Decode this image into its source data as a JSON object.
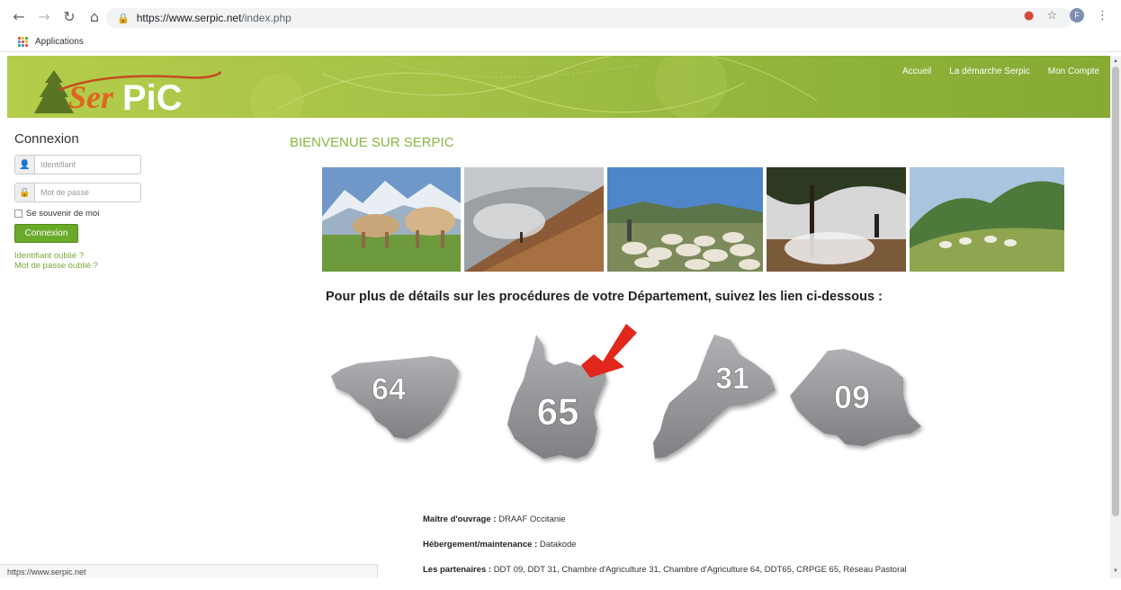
{
  "browser": {
    "url_host": "https://www.serpic.net",
    "url_path": "/index.php",
    "bookmarks": {
      "apps_label": "Applications"
    },
    "profile_initial": "F",
    "status_url": "https://www.serpic.net"
  },
  "header": {
    "nav": [
      "Accueil",
      "La démarche Serpic",
      "Mon Compte"
    ],
    "accent": "#a5c247"
  },
  "login": {
    "title": "Connexion",
    "username_placeholder": "Identifiant",
    "password_placeholder": "Mot de passe",
    "remember_label": "Se souvenir de moi",
    "submit_label": "Connexion",
    "forgot_id": "Identifiant oublié ?",
    "forgot_password": "Mot de passe oublié ?"
  },
  "main": {
    "title": "BIENVENUE SUR SERPIC",
    "caption": "Pour plus de détails sur les procédures de votre Département, suivez les lien ci-dessous :",
    "departments": [
      "64",
      "65",
      "31",
      "09"
    ],
    "highlighted_department": "65"
  },
  "footer": {
    "owner_label": "Maître d'ouvrage :",
    "owner_value": "DRAAF Occitanie",
    "hosting_label": "Hébergement/maintenance :",
    "hosting_value": "Datakode",
    "partners_label": "Les partenaires :",
    "partners_value": "DDT 09, DDT 31, Chambre d'Agriculture 31, Chambre d'Agriculture 64, DDT65, CRPGE 65, Réseau Pastoral"
  }
}
